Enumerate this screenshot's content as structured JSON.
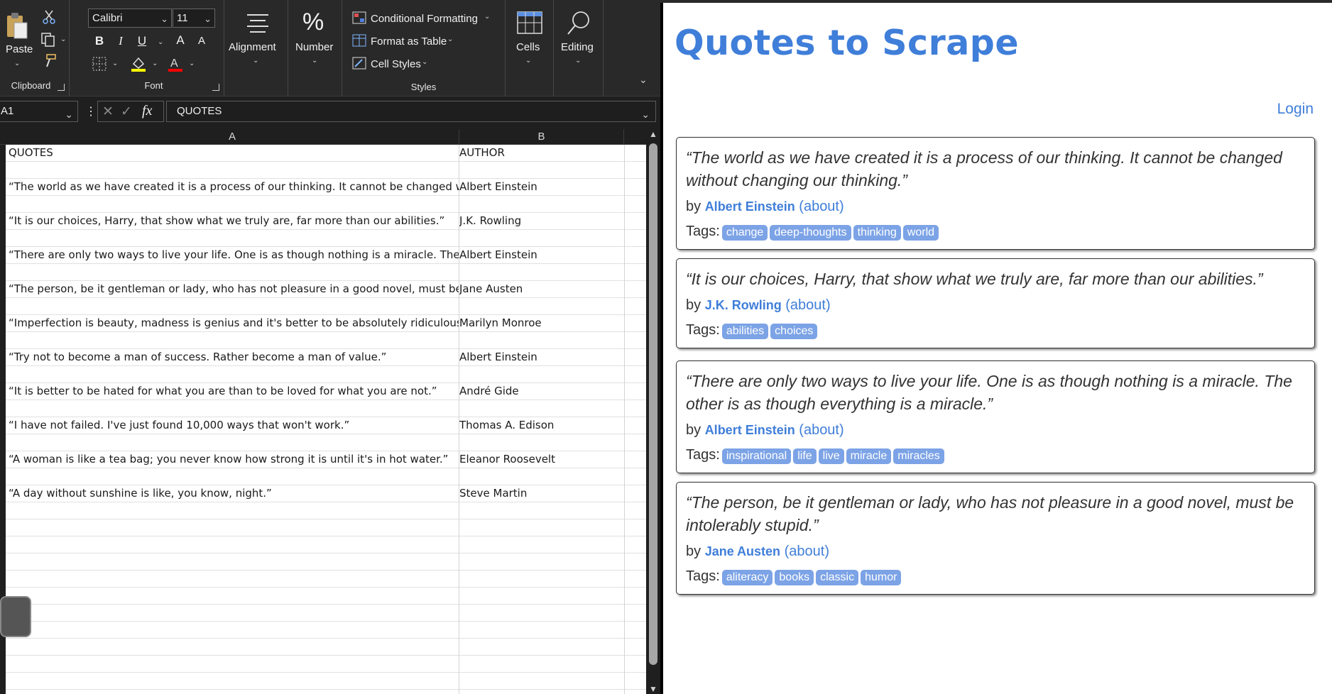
{
  "excel": {
    "ribbon": {
      "clipboard": {
        "paste_label": "Paste",
        "group_label": "Clipboard"
      },
      "font": {
        "font_name": "Calibri",
        "font_size": "11",
        "bold": "B",
        "italic": "I",
        "underline": "U",
        "grow": "A",
        "shrink": "A",
        "group_label": "Font"
      },
      "alignment_label": "Alignment",
      "number_label": "Number",
      "styles": {
        "conditional_formatting": "Conditional Formatting",
        "format_as_table": "Format as Table",
        "cell_styles": "Cell Styles",
        "group_label": "Styles"
      },
      "cells_label": "Cells",
      "editing_label": "Editing"
    },
    "name_box": "A1",
    "formula_value": "QUOTES",
    "columns": [
      "A",
      "B"
    ],
    "rows": [
      {
        "a": "QUOTES",
        "b": "AUTHOR"
      },
      {
        "a": "",
        "b": ""
      },
      {
        "a": "“The world as we have created it is a process of our thinking. It cannot be changed without changing our thinking.”",
        "b": "Albert Einstein"
      },
      {
        "a": "",
        "b": ""
      },
      {
        "a": "“It is our choices, Harry, that show what we truly are, far more than our abilities.”",
        "b": "J.K. Rowling"
      },
      {
        "a": "",
        "b": ""
      },
      {
        "a": "“There are only two ways to live your life. One is as though nothing is a miracle. The other is as though everything is a miracle.”",
        "b": "Albert Einstein"
      },
      {
        "a": "",
        "b": ""
      },
      {
        "a": "“The person, be it gentleman or lady, who has not pleasure in a good novel, must be intolerably stupid.”",
        "b": "Jane Austen"
      },
      {
        "a": "",
        "b": ""
      },
      {
        "a": "“Imperfection is beauty, madness is genius and it's better to be absolutely ridiculous than absolutely boring.”",
        "b": "Marilyn Monroe"
      },
      {
        "a": "",
        "b": ""
      },
      {
        "a": "“Try not to become a man of success. Rather become a man of value.”",
        "b": "Albert Einstein"
      },
      {
        "a": "",
        "b": ""
      },
      {
        "a": "“It is better to be hated for what you are than to be loved for what you are not.”",
        "b": "André Gide"
      },
      {
        "a": "",
        "b": ""
      },
      {
        "a": "“I have not failed. I've just found 10,000 ways that won't work.”",
        "b": "Thomas A. Edison"
      },
      {
        "a": "",
        "b": ""
      },
      {
        "a": "“A woman is like a tea bag; you never know how strong it is until it's in hot water.”",
        "b": "Eleanor Roosevelt"
      },
      {
        "a": "",
        "b": ""
      },
      {
        "a": "“A day without sunshine is like, you know, night.”",
        "b": "Steve Martin"
      }
    ]
  },
  "browser": {
    "site_title": "Quotes to Scrape",
    "login_label": "Login",
    "by_label": "by",
    "about_label": "(about)",
    "tags_label": "Tags:",
    "quotes": [
      {
        "text": "“The world as we have created it is a process of our thinking. It cannot be changed without changing our thinking.”",
        "author": "Albert Einstein",
        "tags": [
          "change",
          "deep-thoughts",
          "thinking",
          "world"
        ]
      },
      {
        "text": "“It is our choices, Harry, that show what we truly are, far more than our abilities.”",
        "author": "J.K. Rowling",
        "tags": [
          "abilities",
          "choices"
        ]
      },
      {
        "text": "“There are only two ways to live your life. One is as though nothing is a miracle. The other is as though everything is a miracle.”",
        "author": "Albert Einstein",
        "tags": [
          "inspirational",
          "life",
          "live",
          "miracle",
          "miracles"
        ]
      },
      {
        "text": "“The person, be it gentleman or lady, who has not pleasure in a good novel, must be intolerably stupid.”",
        "author": "Jane Austen",
        "tags": [
          "aliteracy",
          "books",
          "classic",
          "humor"
        ]
      }
    ]
  }
}
